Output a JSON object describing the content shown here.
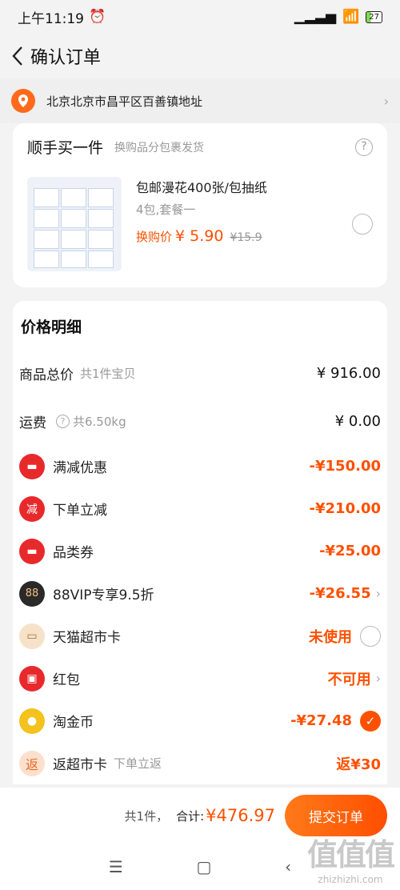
{
  "status": {
    "time": "上午11:19",
    "battery": "27"
  },
  "nav": {
    "title": "确认订单"
  },
  "address": {
    "text": "北京北京市昌平区百善镇地址"
  },
  "addon": {
    "title": "顺手买一件",
    "subtitle": "换购品分包裹发货",
    "product": {
      "name": "包邮漫花400张/包抽纸",
      "spec": "4包,套餐一",
      "price_label": "换购价",
      "price": "¥ 5.90",
      "old_price": "¥15.9"
    }
  },
  "price_detail": {
    "title": "价格明细",
    "rows": [
      {
        "label": "商品总价",
        "sub": "共1件宝贝",
        "value": "¥ 916.00"
      },
      {
        "label": "运费",
        "sub": "共6.50kg",
        "value": "¥ 0.00"
      },
      {
        "label": "满减优惠",
        "value": "-¥150.00"
      },
      {
        "label": "下单立减",
        "value": "-¥210.00"
      },
      {
        "label": "品类券",
        "value": "-¥25.00"
      },
      {
        "label": "88VIP专享9.5折",
        "value": "-¥26.55"
      },
      {
        "label": "天猫超市卡",
        "value": "未使用"
      },
      {
        "label": "红包",
        "value": "不可用"
      },
      {
        "label": "淘金币",
        "value": "-¥27.48"
      },
      {
        "label": "返超市卡",
        "sub": "下单立返",
        "value": "返¥30"
      }
    ]
  },
  "footer": {
    "count": "共1件，",
    "total_label": "合计:",
    "total": "¥476.97",
    "submit": "提交订单"
  },
  "watermark": {
    "big": "值值值",
    "small": "zhizhizhi.com"
  },
  "colors": {
    "accent": "#ff5000",
    "red": "#e8292b"
  }
}
